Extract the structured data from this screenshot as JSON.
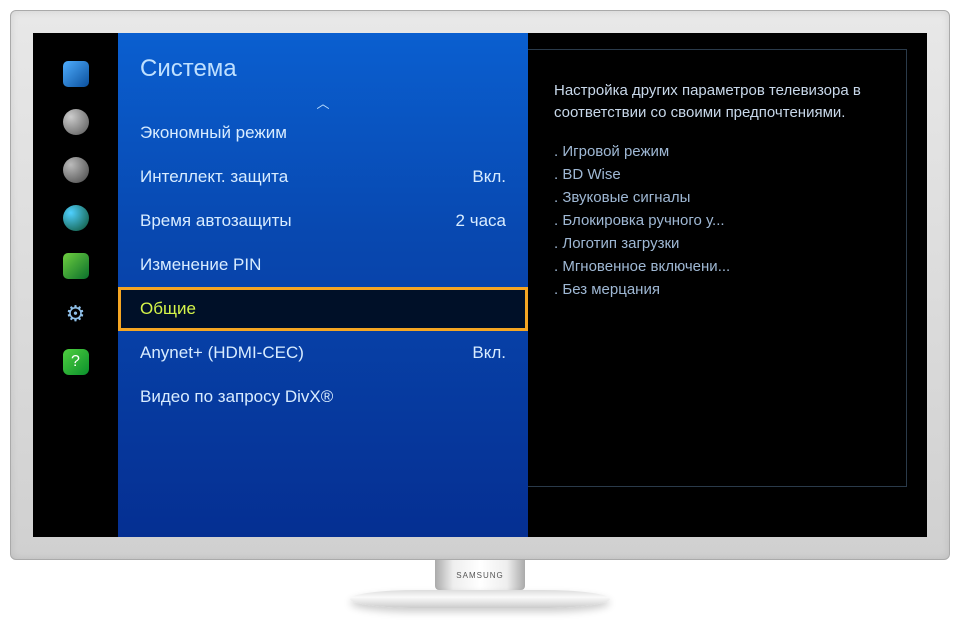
{
  "brand": "SAMSUNG",
  "menu": {
    "title": "Система",
    "items": [
      {
        "label": "Экономный режим",
        "value": ""
      },
      {
        "label": "Интеллект. защита",
        "value": "Вкл."
      },
      {
        "label": "Время автозащиты",
        "value": "2 часа"
      },
      {
        "label": "Изменение PIN",
        "value": ""
      },
      {
        "label": "Общие",
        "value": "",
        "selected": true
      },
      {
        "label": "Anynet+ (HDMI-CEC)",
        "value": "Вкл."
      },
      {
        "label": "Видео по запросу DivX®",
        "value": ""
      }
    ]
  },
  "info": {
    "description": "Настройка других параметров телевизора в соответствии со своими предпочтениями.",
    "bullets": [
      "Игровой режим",
      "BD Wise",
      "Звуковые сигналы",
      "Блокировка ручного у...",
      "Логотип загрузки",
      "Мгновенное включени...",
      "Без мерцания"
    ]
  },
  "rail": [
    {
      "name": "picture-icon"
    },
    {
      "name": "sound-icon"
    },
    {
      "name": "broadcast-icon"
    },
    {
      "name": "network-icon"
    },
    {
      "name": "smarthub-icon"
    },
    {
      "name": "system-icon"
    },
    {
      "name": "support-icon"
    }
  ]
}
